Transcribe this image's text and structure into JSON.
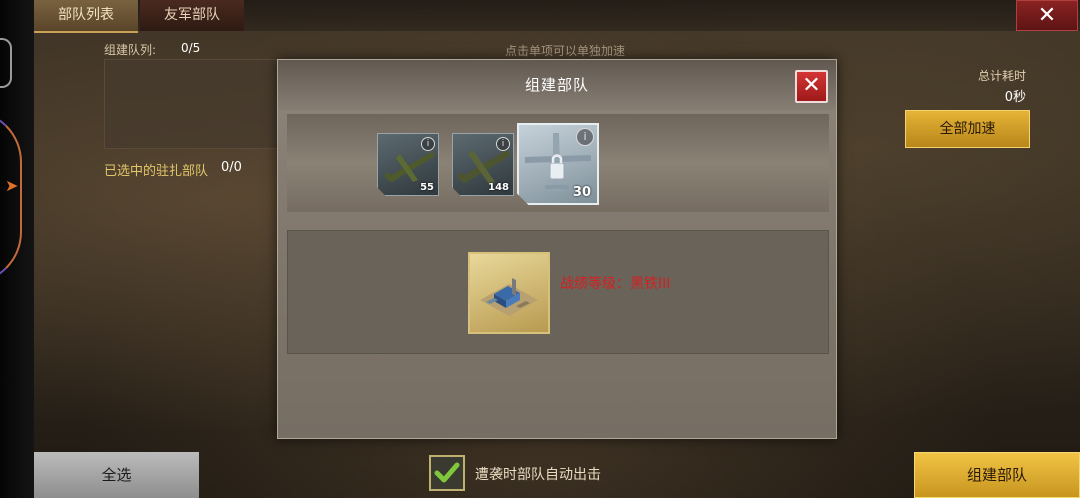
{
  "tabs": {
    "troop_list": "部队列表",
    "allied_troops": "友军部队"
  },
  "background_panel": {
    "queue_label": "组建队列:",
    "queue_count": "0/5",
    "hint": "点击单项可以单独加速",
    "selected_label": "已选中的驻扎部队",
    "selected_count": "0/0",
    "total_time_label": "总计耗时",
    "total_time_value": "0秒",
    "speed_all_button": "全部加速"
  },
  "bottom_bar": {
    "select_all_button": "全选",
    "auto_sortie_label": "遭袭时部队自动出击",
    "auto_sortie_checked": true,
    "build_button": "组建部队"
  },
  "modal": {
    "title": "组建部队",
    "units": [
      {
        "name": "fighter-plane",
        "count": "55"
      },
      {
        "name": "bomber-plane",
        "count": "148"
      },
      {
        "name": "heavy-bomber-plane",
        "count": "30",
        "selected": true,
        "locked": true
      }
    ],
    "rank_text": "战绩等级：黑铁III"
  },
  "colors": {
    "accent_gold": "#e5b437",
    "close_red": "#c42a2a",
    "rank_red": "#d42020",
    "selected_label_gold": "#e2c76a"
  }
}
